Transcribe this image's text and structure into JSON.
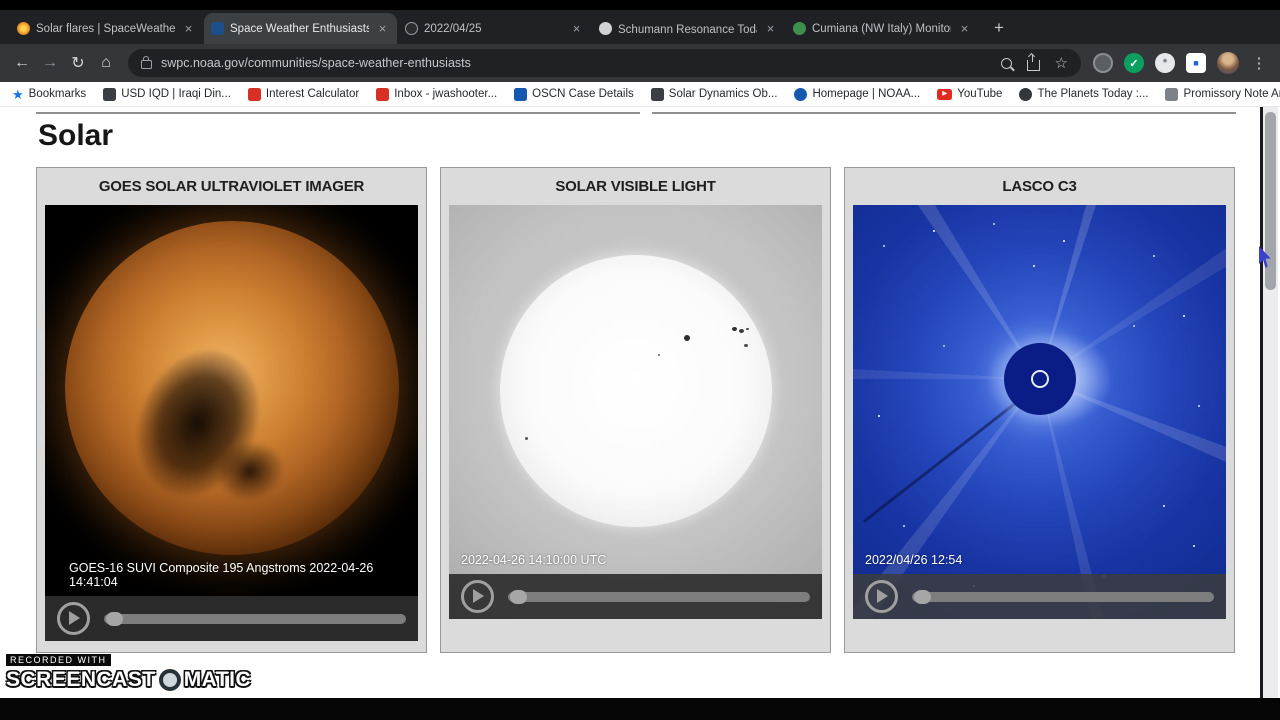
{
  "browser": {
    "tabs": [
      {
        "label": "Solar flares | SpaceWeatherLive.c"
      },
      {
        "label": "Space Weather Enthusiasts Dash"
      },
      {
        "label": "2022/04/25"
      },
      {
        "label": "Schumann Resonance Today ⚡"
      },
      {
        "label": "Cumiana (NW Italy) Monitoring S"
      }
    ],
    "url": "swpc.noaa.gov/communities/space-weather-enthusiasts",
    "bookmarks": [
      {
        "label": "Bookmarks"
      },
      {
        "label": "USD IQD | Iraqi Din..."
      },
      {
        "label": "Interest Calculator"
      },
      {
        "label": "Inbox - jwashooter..."
      },
      {
        "label": "OSCN Case Details"
      },
      {
        "label": "Solar Dynamics Ob..."
      },
      {
        "label": "Homepage | NOAA..."
      },
      {
        "label": "YouTube"
      },
      {
        "label": "The Planets Today :..."
      },
      {
        "label": "Promissory Note Ar..."
      }
    ]
  },
  "icons": {
    "back": "←",
    "forward": "→",
    "reload": "↻",
    "home": "⌂",
    "star": "☆",
    "kebab": "⋮",
    "plus": "+",
    "close": "×",
    "overflow": "»",
    "bookmarks_star": "★",
    "play": "▶",
    "check": "✓",
    "asterisk": "*",
    "square": "■"
  },
  "page": {
    "heading": "Solar",
    "panels": [
      {
        "title": "GOES SOLAR ULTRAVIOLET IMAGER",
        "caption": "GOES-16 SUVI Composite 195 Angstroms 2022-04-26 14:41:04"
      },
      {
        "title": "SOLAR VISIBLE LIGHT",
        "caption": "2022-04-26 14:10:00 UTC"
      },
      {
        "title": "LASCO C3",
        "caption": "2022/04/26 12:54"
      }
    ]
  },
  "watermark": {
    "prefix": "RECORDED WITH",
    "brand_left": "SCREENCAST",
    "brand_right": "MATIC"
  },
  "colors": {
    "lasco_blue": "#1d3cb4",
    "suvi_orange": "#cc7f30",
    "toolbar_dark": "#35363a",
    "youtube_red": "#e02b20",
    "check_green": "#0ba05f"
  }
}
